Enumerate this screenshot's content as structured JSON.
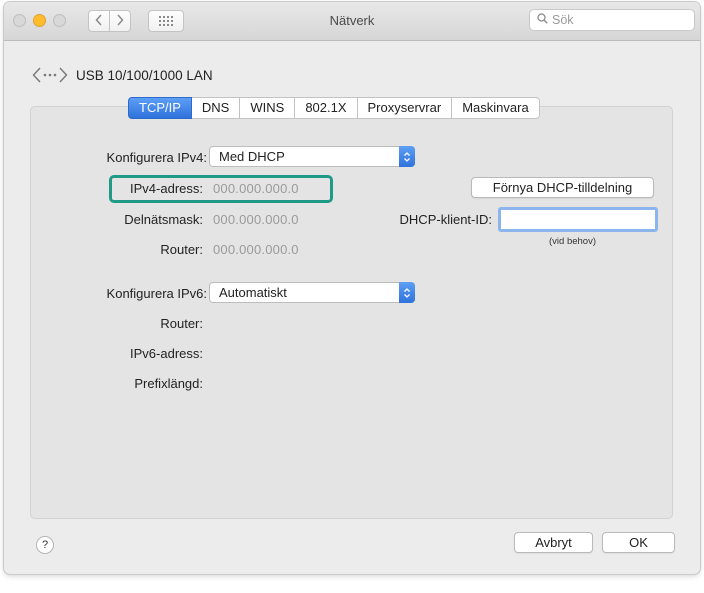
{
  "window": {
    "title": "Nätverk"
  },
  "toolbar": {
    "search_placeholder": "Sök",
    "back_icon": "chevron-left-icon",
    "forward_icon": "chevron-right-icon",
    "grid_icon": "grid-icon"
  },
  "interface": {
    "name": "USB 10/100/1000 LAN",
    "icon": "ethernet-icon"
  },
  "tabs": [
    "TCP/IP",
    "DNS",
    "WINS",
    "802.1X",
    "Proxyservrar",
    "Maskinvara"
  ],
  "active_tab": "TCP/IP",
  "ipv4": {
    "configure_label": "Konfigurera IPv4:",
    "configure_value": "Med DHCP",
    "address_label": "IPv4-adress:",
    "address_value": "000.000.000.0",
    "subnet_label": "Delnätsmask:",
    "subnet_value": "000.000.000.0",
    "router_label": "Router:",
    "router_value": "000.000.000.0",
    "renew_button": "Förnya DHCP-tilldelning",
    "client_id_label": "DHCP-klient-ID:",
    "client_id_value": "",
    "client_id_hint": "(vid behov)"
  },
  "ipv6": {
    "configure_label": "Konfigurera IPv6:",
    "configure_value": "Automatiskt",
    "router_label": "Router:",
    "address_label": "IPv6-adress:",
    "prefix_label": "Prefixlängd:"
  },
  "footer": {
    "help_label": "?",
    "cancel_label": "Avbryt",
    "ok_label": "OK"
  },
  "colors": {
    "accent": "#2e72dc",
    "highlight": "#1f9a86",
    "focus_ring": "#8cb5ee"
  }
}
